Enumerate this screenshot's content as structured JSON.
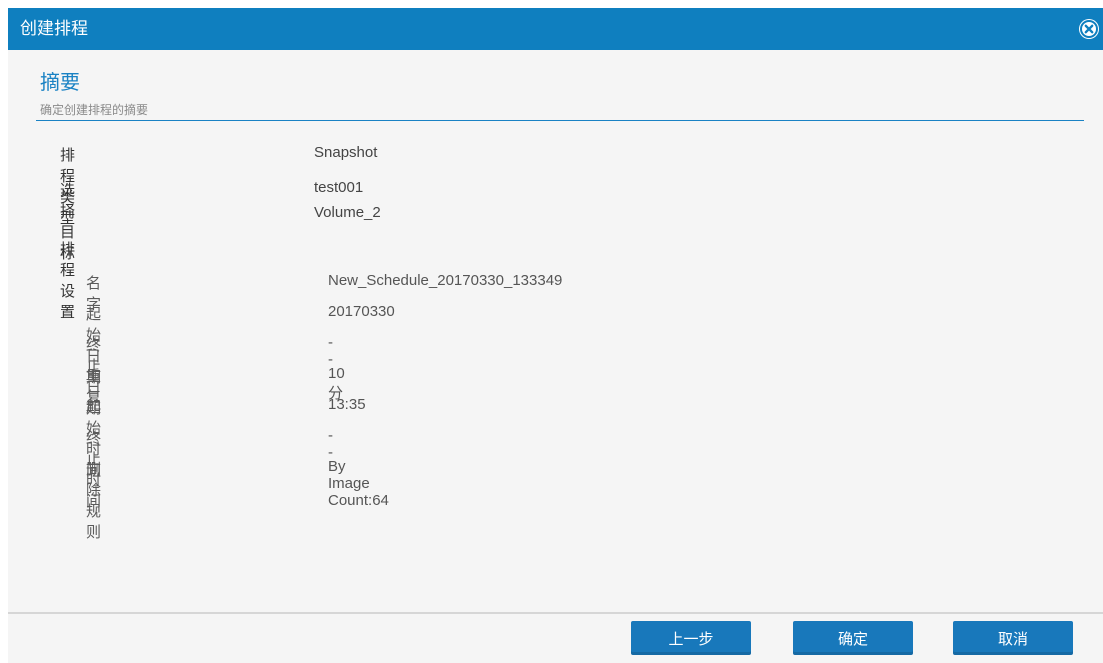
{
  "dialog": {
    "title": "创建排程",
    "close_icon": "close-circle-icon",
    "accent": "#0f7fbf"
  },
  "section": {
    "title": "摘要",
    "subtitle": "确定创建排程的摘要"
  },
  "summary": {
    "schedule_type_label": "排程类型",
    "schedule_type_value": "Snapshot",
    "targets_label": "选择目标",
    "targets": [
      "test001",
      "Volume_2"
    ],
    "settings_label": "排程设置"
  },
  "settings": [
    {
      "label": "名字",
      "value": "New_Schedule_20170330_133349"
    },
    {
      "label": "起始日期",
      "value": "20170330"
    },
    {
      "label": "终止日期",
      "value": "--"
    },
    {
      "label": "重复",
      "value": "10 分"
    },
    {
      "label": "起始时间",
      "value": "13:35"
    },
    {
      "label": "终止时间",
      "value": "--"
    },
    {
      "label": "删除规则",
      "value": "By Image Count:64"
    }
  ],
  "buttons": {
    "prev": "上一步",
    "confirm": "确定",
    "cancel": "取消"
  }
}
